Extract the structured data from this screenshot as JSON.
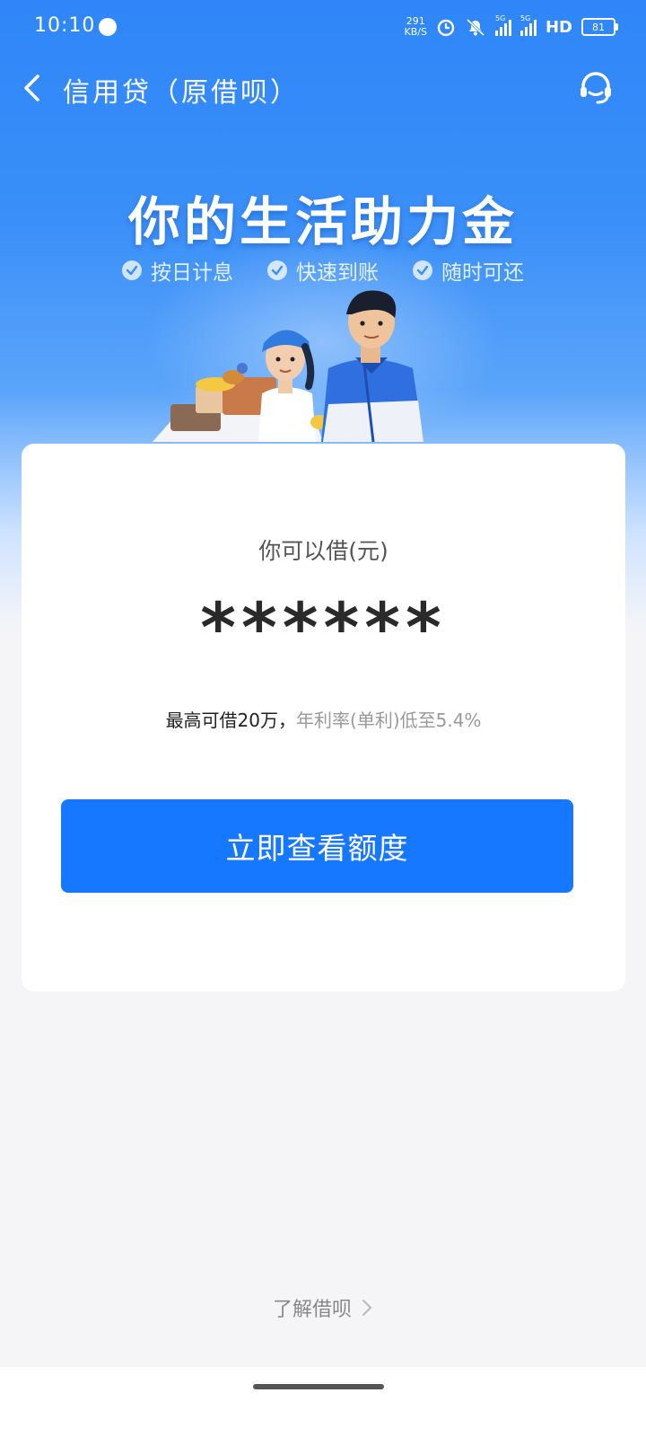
{
  "status_bar": {
    "time": "10:10",
    "net_speed_value": "291",
    "net_speed_unit": "KB/S",
    "signal_label_1": "5G",
    "signal_label_2": "5G",
    "hd_label": "HD",
    "battery": "81"
  },
  "nav": {
    "title": "信用贷（原借呗）",
    "back_icon": "chevron-left-icon",
    "support_icon": "headset-icon"
  },
  "hero": {
    "headline": "你的生活助力金",
    "features": [
      "按日计息",
      "快速到账",
      "随时可还"
    ]
  },
  "card": {
    "borrow_label": "你可以借(元)",
    "masked_amount": "******",
    "max_text": "最高可借20万，",
    "rate_text": "年利率(单利)低至5.4%",
    "cta_label": "立即查看额度"
  },
  "footer": {
    "learn_more": "了解借呗"
  },
  "colors": {
    "brand_blue": "#1677ff",
    "hero_blue": "#2f86f8",
    "background": "#f5f5f8"
  }
}
